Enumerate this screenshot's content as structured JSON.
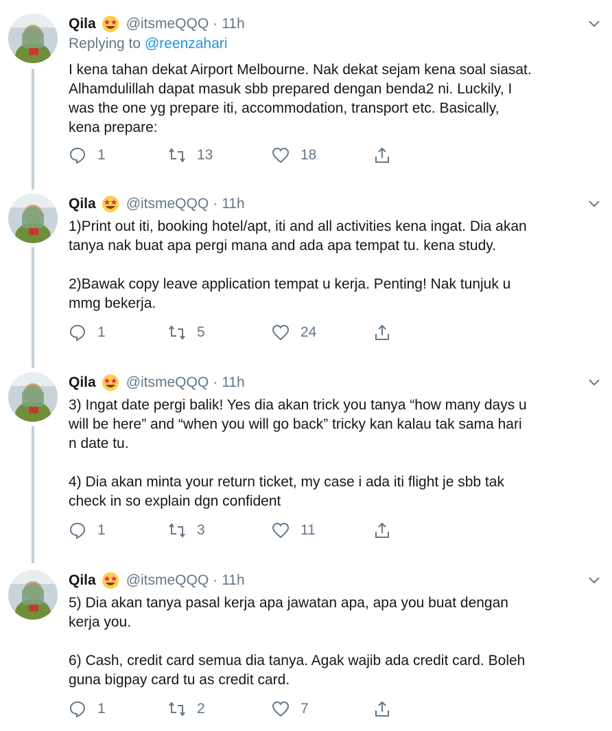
{
  "tweets": [
    {
      "name": "Qila",
      "handle": "@itsmeQQQ",
      "dot": "·",
      "time": "11h",
      "replying_prefix": "Replying to ",
      "replying_to": "@reenzahari",
      "text": "I kena tahan dekat Airport Melbourne. Nak dekat sejam kena soal siasat.\nAlhamdulillah dapat masuk sbb prepared dengan benda2 ni. Luckily, I\nwas the one yg prepare iti, accommodation, transport etc. Basically,\nkena prepare:",
      "replies": "1",
      "retweets": "13",
      "likes": "18"
    },
    {
      "name": "Qila",
      "handle": "@itsmeQQQ",
      "dot": "·",
      "time": "11h",
      "text": "1)Print out iti, booking hotel/apt, iti and all activities kena ingat. Dia akan\ntanya nak buat apa pergi mana and ada apa tempat tu. kena study.\n\n2)Bawak copy leave application tempat u kerja. Penting! Nak tunjuk u\nmmg bekerja.",
      "replies": "1",
      "retweets": "5",
      "likes": "24"
    },
    {
      "name": "Qila",
      "handle": "@itsmeQQQ",
      "dot": "·",
      "time": "11h",
      "text": "3) Ingat date pergi balik! Yes dia akan trick you tanya “how many days u\nwill be here” and “when you will go back” tricky kan kalau tak sama hari\nn date tu.\n\n4) Dia akan minta your return ticket, my case i ada iti flight je sbb tak\ncheck in so explain dgn confident",
      "replies": "1",
      "retweets": "3",
      "likes": "11"
    },
    {
      "name": "Qila",
      "handle": "@itsmeQQQ",
      "dot": "·",
      "time": "11h",
      "text": "5) Dia akan tanya pasal kerja apa jawatan apa, apa you buat dengan\nkerja you.\n\n6) Cash, credit card semua dia tanya. Agak wajib ada credit card. Boleh\nguna bigpay card tu as credit card.",
      "replies": "1",
      "retweets": "2",
      "likes": "7"
    }
  ],
  "icons": {
    "emoji": "star-struck-emoji-icon",
    "caret": "chevron-down-icon",
    "reply": "reply-icon",
    "retweet": "retweet-icon",
    "like": "heart-icon",
    "share": "share-icon"
  },
  "colors": {
    "text": "#14171a",
    "secondary": "#657786",
    "link": "#1b95e0",
    "thread_line": "#c4cfd6"
  }
}
